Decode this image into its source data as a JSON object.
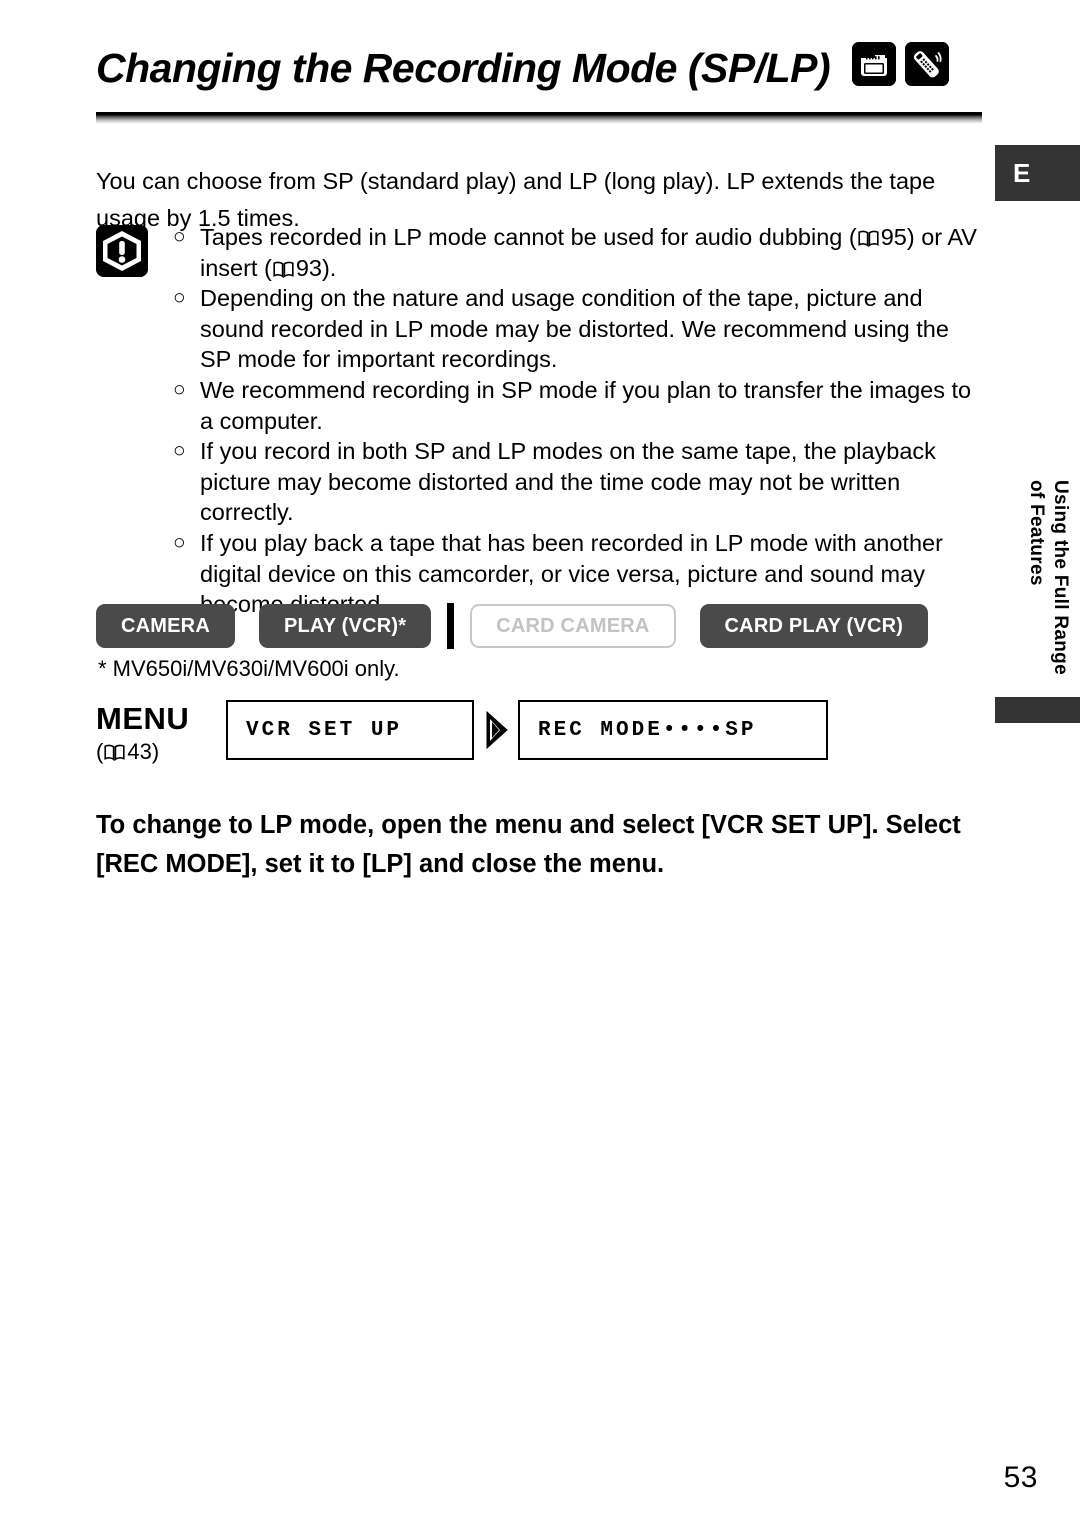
{
  "header": {
    "title": "Changing the Recording Mode (SP/LP)",
    "icons": [
      {
        "name": "tape-camcorder-icon",
        "label": "Tape"
      },
      {
        "name": "remote-control-icon",
        "label": "Remote"
      }
    ]
  },
  "language_tab": {
    "label": "E"
  },
  "intro": {
    "text": "You can choose from SP (standard play) and LP (long play). LP extends the tape usage by 1.5 times."
  },
  "warning": {
    "icon": "warning-exclamation-icon",
    "bullets": [
      {
        "prefix": "Tapes recorded in LP mode cannot be used for audio dubbing (",
        "ref1": "95",
        "mid": ") or AV insert (",
        "ref2": "93",
        "suffix": ")."
      },
      {
        "text": "Depending on the nature and usage condition of the tape, picture and sound recorded in LP mode may be distorted. We recommend using the SP mode for important recordings."
      },
      {
        "text": "We recommend recording in SP mode if you plan to transfer the images to a computer."
      },
      {
        "text": "If you record in both SP and LP modes on the same tape, the playback picture may become distorted and the time code may not be written correctly."
      },
      {
        "text": "If you play back a tape that has been recorded in LP mode with another digital device on this camcorder, or vice versa, picture and sound may become distorted."
      }
    ]
  },
  "modes": {
    "badges": [
      {
        "label": "CAMERA",
        "state": "enabled"
      },
      {
        "label": "PLAY (VCR)*",
        "state": "enabled"
      },
      {
        "label": "CARD CAMERA",
        "state": "disabled"
      },
      {
        "label": "CARD PLAY (VCR)",
        "state": "enabled"
      }
    ],
    "footnote": "* MV650i/MV630i/MV600i only."
  },
  "menu": {
    "word": "MENU",
    "ref_page": "43",
    "ref_open": "(",
    "ref_close": ")",
    "step1": "VCR SET UP",
    "step2": "REC MODE••••SP"
  },
  "instruction": {
    "text": "To change to LP mode, open the menu and select [VCR SET UP]. Select [REC MODE], set it to [LP] and close the menu."
  },
  "side_tab": {
    "line1": "Using the Full Range",
    "line2": "of Features"
  },
  "page_number": "53",
  "colors": {
    "badge_on_bg": "#4a4a4a",
    "badge_off_border": "#c8c8c8",
    "badge_off_text": "#c3c3c3",
    "tab_bg": "#333333",
    "ink": "#000000"
  }
}
